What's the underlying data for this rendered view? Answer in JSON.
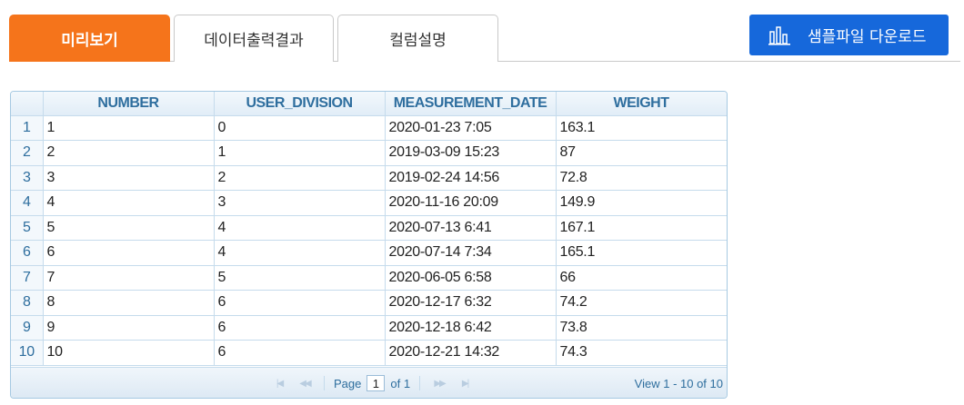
{
  "tabs": [
    "미리보기",
    "데이터출력결과",
    "컬럼설명"
  ],
  "download_button": {
    "label": "샘플파일 다운로드",
    "icon": "bar-chart-icon"
  },
  "grid": {
    "columns": [
      "NUMBER",
      "USER_DIVISION",
      "MEASUREMENT_DATE",
      "WEIGHT"
    ],
    "rows": [
      {
        "n": "1",
        "cells": [
          "1",
          "0",
          "2020-01-23 7:05",
          "163.1"
        ]
      },
      {
        "n": "2",
        "cells": [
          "2",
          "1",
          "2019-03-09 15:23",
          "87"
        ]
      },
      {
        "n": "3",
        "cells": [
          "3",
          "2",
          "2019-02-24 14:56",
          "72.8"
        ]
      },
      {
        "n": "4",
        "cells": [
          "4",
          "3",
          "2020-11-16 20:09",
          "149.9"
        ]
      },
      {
        "n": "5",
        "cells": [
          "5",
          "4",
          "2020-07-13 6:41",
          "167.1"
        ]
      },
      {
        "n": "6",
        "cells": [
          "6",
          "4",
          "2020-07-14 7:34",
          "165.1"
        ]
      },
      {
        "n": "7",
        "cells": [
          "7",
          "5",
          "2020-06-05 6:58",
          "66"
        ]
      },
      {
        "n": "8",
        "cells": [
          "8",
          "6",
          "2020-12-17 6:32",
          "74.2"
        ]
      },
      {
        "n": "9",
        "cells": [
          "9",
          "6",
          "2020-12-18 6:42",
          "73.8"
        ]
      },
      {
        "n": "10",
        "cells": [
          "10",
          "6",
          "2020-12-21 14:32",
          "74.3"
        ]
      }
    ]
  },
  "pager": {
    "page_label": "Page",
    "page_value": "1",
    "of_label": "of 1",
    "view_text": "View 1 - 10 of 10"
  },
  "colors": {
    "accent_tab": "#f5741b",
    "download_button": "#1668db",
    "grid_header_text": "#2e6e9e"
  }
}
